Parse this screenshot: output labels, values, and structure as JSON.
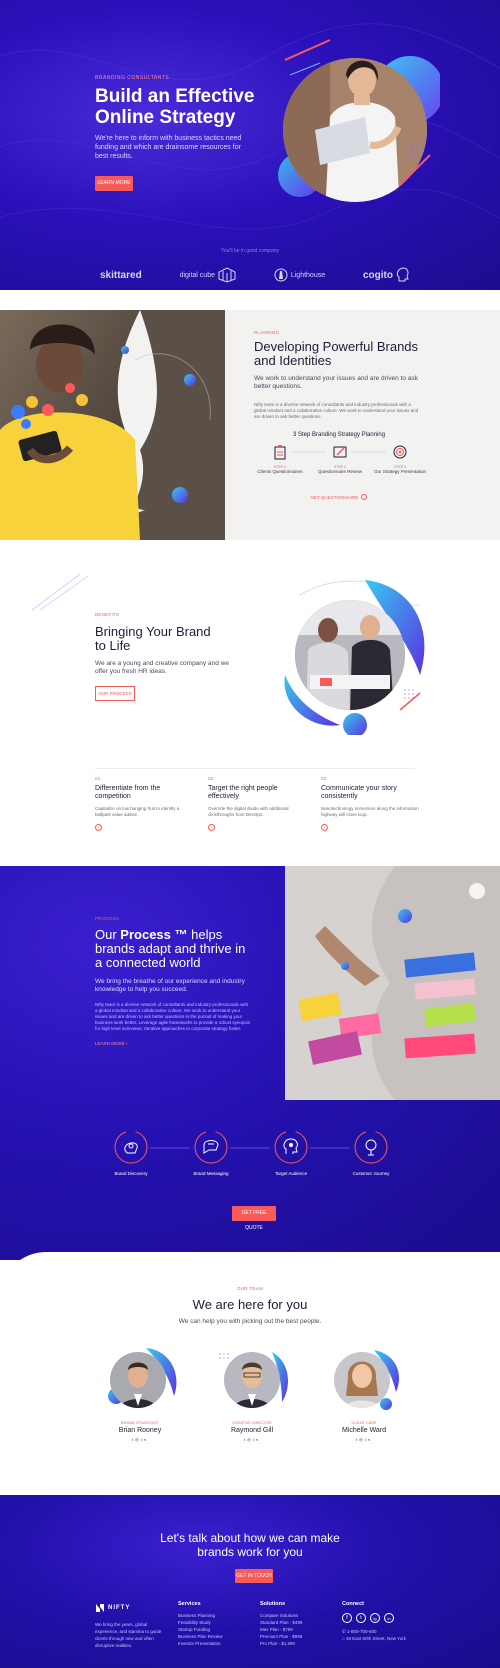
{
  "hero": {
    "eyebrow": "BRANDING CONSULTANTS",
    "title_line1": "Build an Effective",
    "title_line2": "Online Strategy",
    "lead": "We're here to inform with business tactics need funding and which are drainsome resources for best results.",
    "cta": "LEARN MORE",
    "good_company": "You'll be in good company",
    "logos": [
      "skittared",
      "digital cube",
      "Lighthouse",
      "cogito"
    ]
  },
  "planning": {
    "eyebrow": "PLANNING",
    "title": "Developing Powerful Brands and Identities",
    "lead": "We work to understand your issues and are driven to ask better questions.",
    "body": "Nifty team is a diverse network of consultants and industry professionals with a global mindset and a collaborative culture. We work to understand your issues and are driven to ask better questions.",
    "steps_title": "3 Step Branding Strategy Planning",
    "steps": [
      {
        "num": "STEP 1",
        "label": "Clients Questionnaires"
      },
      {
        "num": "STEP 2",
        "label": "Questionnaire Review"
      },
      {
        "num": "STEP 3",
        "label": "Our Strategy Presentation"
      }
    ],
    "link": "GET QUESTIONNAIRE"
  },
  "brand": {
    "eyebrow": "BENEFITS",
    "title": "Bringing Your Brand to Life",
    "lead": "We are a young and creative company and we offer you fresh HR ideas.",
    "button": "OUR PROCESS",
    "features": [
      {
        "num": "01",
        "title": "Differentiate from the competition",
        "text": "Capitalize on low hanging fruit to identify a ballpark value added."
      },
      {
        "num": "02",
        "title": "Target the right people effectively",
        "text": "Override the digital divide with additional clickthroughs from DevOps."
      },
      {
        "num": "03",
        "title": "Communicate your story consistently",
        "text": "Nanotechnology immersion along the information highway will close loop."
      }
    ]
  },
  "process": {
    "eyebrow": "PROCESS",
    "title_pre": "Our ",
    "title_bold": "Process ™",
    "title_post": " helps brands adapt and thrive in a connected world",
    "lead": "We bring the breathe of our experience and industry knowledge to help you succeed.",
    "body": "Nifty team is a diverse network of consultants and industry professionals with a global mindset and a collaborative culture. We work to understand your issues and are driven to ask better questions in the pursuit of making your business work better. Leverage agile frameworks to provide a robust synopsis for high level overviews. Iterative approaches to corporate strategy foster.",
    "link": "LEARN MORE",
    "steps": [
      "Brand Discovery",
      "Brand Messaging",
      "Target Audience",
      "Customer Journey"
    ],
    "cta": "GET FREE QUOTE"
  },
  "team": {
    "eyebrow": "OUR TEAM",
    "title": "We are here for you",
    "lead": "We can help you with picking out the best people.",
    "members": [
      {
        "role": "BRAND STRATEGIST",
        "name": "Brian Rooney"
      },
      {
        "role": "CREATIVE DIRECTOR",
        "name": "Raymond Gill"
      },
      {
        "role": "CLIENT CARE",
        "name": "Michelle Ward"
      }
    ]
  },
  "footer": {
    "cta_title_1": "Let's talk about how we can make",
    "cta_title_2": "brands work for you",
    "cta_button": "GET IN TOUCH",
    "brand": "NIFTY",
    "about": "We bring the years, global experience, and stamina to guide clients through new and often disruptive realities.",
    "services_title": "Services",
    "services": [
      "Business Planning",
      "Feasibility Study",
      "Startup Funding",
      "Business Plan Review",
      "Investor Presentation"
    ],
    "solutions_title": "Solutions",
    "solutions": [
      "Compare Solutions",
      "Standard Plan - $499",
      "Max Plan - $799",
      "Premium Plan - $999",
      "Pro Plan - $1,990"
    ],
    "connect_title": "Connect",
    "phone": "1-800-700-600",
    "address": "48 East 60th Street, New York",
    "socials": [
      "f",
      "t",
      "ig",
      "in"
    ]
  },
  "colors": {
    "accent": "#f85a5a",
    "primary": "#2411b0",
    "cyan": "#38c9f0"
  }
}
